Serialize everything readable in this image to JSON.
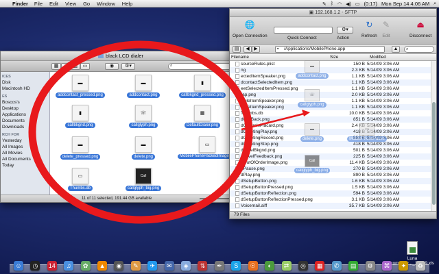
{
  "menubar": {
    "app": "Finder",
    "menus": [
      "File",
      "Edit",
      "View",
      "Go",
      "Window",
      "Help"
    ],
    "battery": "(0:17)",
    "clock": "Mon Sep 14  4:06 AM"
  },
  "finder": {
    "title": "black LCD dialer",
    "search_placeholder": "",
    "sidebar": [
      {
        "section": "ICES",
        "items": [
          "Disk",
          "Macintosh HD"
        ]
      },
      {
        "section": "ES",
        "items": [
          "Boscos's",
          "Desktop",
          "Applications",
          "Documents",
          "Downloads"
        ]
      },
      {
        "section": "RCH FOR",
        "items": [
          "Yesterday",
          "All Images",
          "All Movies",
          "All Documents",
          "Today"
        ]
      }
    ],
    "files": [
      {
        "name": "addcontact_pressed.png",
        "glyph": "▬"
      },
      {
        "name": "addcontact.png",
        "glyph": "▬"
      },
      {
        "name": "callbkgnd_pressed.png",
        "glyph": "▮"
      },
      {
        "name": "callbkgnd.png",
        "glyph": "▮"
      },
      {
        "name": "callglyph.png",
        "glyph": "☏"
      },
      {
        "name": "DefaultDialer.png",
        "glyph": "▦"
      },
      {
        "name": "delete_pressed.png",
        "glyph": "▬"
      },
      {
        "name": "delete.png",
        "glyph": "▬"
      },
      {
        "name": "MobilePhonePackedImages.artwork",
        "glyph": "▭"
      },
      {
        "name": "Thumbs.db",
        "glyph": "▭"
      },
      {
        "name": "callglyph_big.png",
        "glyph": "Call"
      }
    ],
    "status": "11 of 11 selected, 191.44 GB available"
  },
  "sftp": {
    "title": "192.168.1.2 - SFTP",
    "toolbar": {
      "open_connection": "Open Connection",
      "quick_connect": "Quick Connect",
      "action": "Action",
      "refresh": "Refresh",
      "edit": "Edit",
      "disconnect": "Disconnect"
    },
    "path": "/Applications/MobilePhone.app",
    "columns": {
      "filename": "Filename",
      "size": "Size",
      "modified": "Modified"
    },
    "rows": [
      {
        "name": "sourceRules.plist",
        "size": "150 B",
        "date": "5/14/09 3:06 AM"
      },
      {
        "name": "ng",
        "size": "2.3 KB",
        "date": "5/14/09 3:06 AM"
      },
      {
        "name": "ectedItemSpeaker.png",
        "size": "1.1 KB",
        "date": "5/14/09 3:06 AM"
      },
      {
        "name": "dcontactSelectedItem.png",
        "size": "1.1 KB",
        "date": "5/14/09 3:06 AM"
      },
      {
        "name": "eetSelectedItemPressed.png",
        "size": "1.1 KB",
        "date": "5/14/09 3:06 AM"
      },
      {
        "name": "rap.png",
        "size": "2.0 KB",
        "date": "5/14/09 3:06 AM"
      },
      {
        "name": "obileItemSpeaker.png",
        "size": "1.1 KB",
        "date": "5/14/09 3:06 AM"
      },
      {
        "name": "obileItemSpeaker.png",
        "size": "1.1 KB",
        "date": "5/14/09 3:06 AM"
      },
      {
        "name": "Thumbs.db",
        "size": "10.0 KB",
        "date": "5/14/09 3:06 AM"
      },
      {
        "name": "dCallBack.png",
        "size": "851 B",
        "date": "5/14/09 3:06 AM"
      },
      {
        "name": "dControlsPlacard.png",
        "size": "2.4 KB",
        "date": "5/14/09 3:06 AM"
      },
      {
        "name": "dGreetingPlay.png",
        "size": "418 B",
        "date": "5/14/09 3:06 AM"
      },
      {
        "name": "dGreetingRecord.png",
        "size": "553 B",
        "date": "5/14/09 3:06 AM"
      },
      {
        "name": "dGreetingStop.png",
        "size": "418 B",
        "date": "5/14/09 3:06 AM"
      },
      {
        "name": "dLevelBkgnd.png",
        "size": "501 B",
        "date": "5/14/09 3:06 AM"
      },
      {
        "name": "dLevelFeedback.png",
        "size": "225 B",
        "date": "5/14/09 3:06 AM"
      },
      {
        "name": "dOutOfOrderImage.png",
        "size": "11.4 KB",
        "date": "5/14/09 3:06 AM"
      },
      {
        "name": "dPause.png",
        "size": "270 B",
        "date": "5/14/09 3:06 AM"
      },
      {
        "name": "dPlay.png",
        "size": "890 B",
        "date": "5/14/09 3:06 AM"
      },
      {
        "name": "dSetupButton.png",
        "size": "1.6 KB",
        "date": "5/14/09 3:06 AM"
      },
      {
        "name": "dSetupButtonPressed.png",
        "size": "1.5 KB",
        "date": "5/14/09 3:06 AM"
      },
      {
        "name": "dSetupButtonReflection.png",
        "size": "594 B",
        "date": "5/14/09 3:06 AM"
      },
      {
        "name": "dSetupButtonReflectionPressed.png",
        "size": "3.1 KB",
        "date": "5/14/09 3:06 AM"
      },
      {
        "name": "Voicemail.aiff",
        "size": "35.7 KB",
        "date": "5/14/09 3:06 AM"
      }
    ],
    "status": "79 Files"
  },
  "ghosts": [
    {
      "name": "addcontact.png",
      "glyph": "▬"
    },
    {
      "name": "callglyph.png",
      "glyph": "☏"
    },
    {
      "name": "delete.png",
      "glyph": "▬"
    },
    {
      "name": "MobilePhonePacke",
      "glyph": "▭"
    },
    {
      "name": "callglyph_big.png",
      "glyph": "Call"
    }
  ],
  "desktop_icon": {
    "name_line1": "Luna",
    "name_line2": "commerc..._28_09.xls"
  },
  "dock": [
    "finder-icon",
    "dashboard-icon",
    "calendar-icon",
    "itunes-icon",
    "photos-icon",
    "vlc-icon",
    "camera-icon",
    "sketch-icon",
    "safari-icon",
    "mail-icon",
    "preview-icon",
    "ftp-icon",
    "pen-icon",
    "skype-icon",
    "firefox-icon",
    "adium-icon",
    "transmit-icon",
    "dvd-icon",
    "ical-icon",
    "chat-icon",
    "activity-icon",
    "settings-icon",
    "scripts-icon",
    "puzzle-icon",
    "trash-icon"
  ],
  "colors": {
    "selection": "#3875d7",
    "annotation": "#e8191c"
  }
}
